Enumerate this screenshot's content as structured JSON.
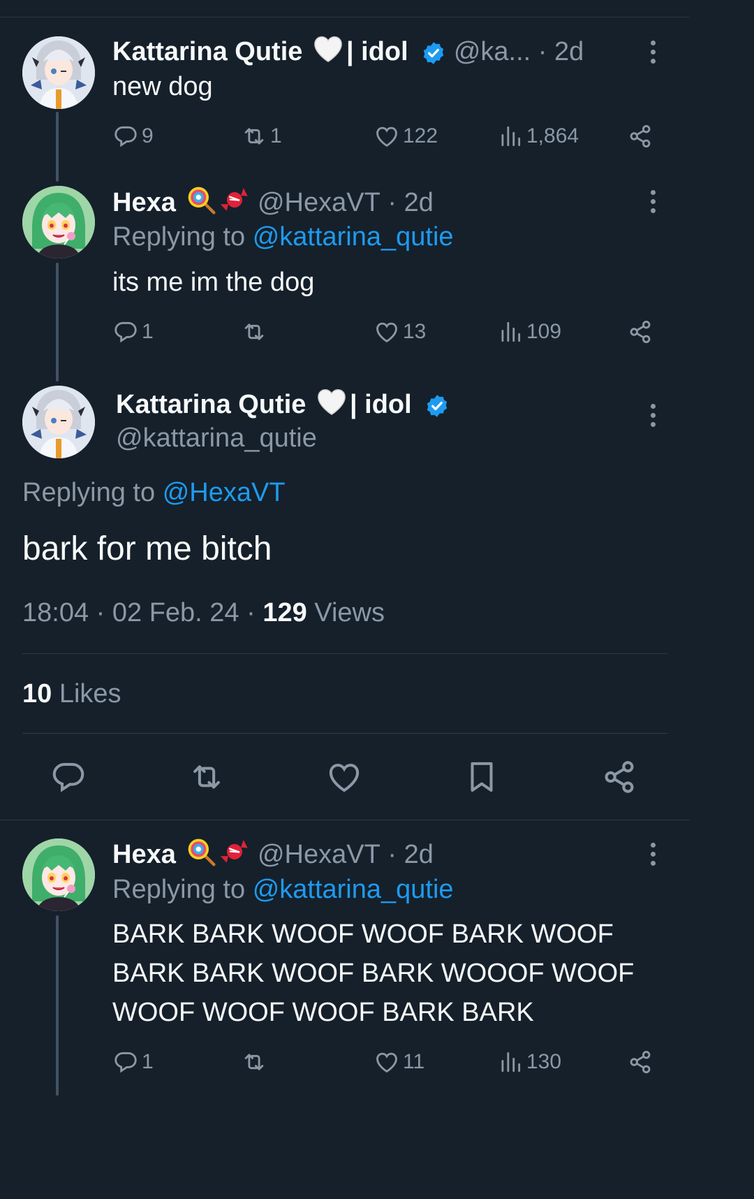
{
  "tweets": [
    {
      "name": "Kattarina Qutie",
      "name_suffix": "| idol",
      "handle": "@ka...",
      "time": "· 2d",
      "text": "new dog",
      "replies": "9",
      "retweets": "1",
      "likes": "122",
      "views": "1,864"
    },
    {
      "name": "Hexa",
      "handle": "@HexaVT",
      "time": "· 2d",
      "replying_prefix": "Replying to",
      "replying_to": "@kattarina_qutie",
      "text": "its me im the dog",
      "replies": "1",
      "retweets": "",
      "likes": "13",
      "views": "109"
    }
  ],
  "main": {
    "name": "Kattarina Qutie",
    "name_suffix": "| idol",
    "handle": "@kattarina_qutie",
    "replying_prefix": "Replying to",
    "replying_to": "@HexaVT",
    "text": "bark for me bitch",
    "timestamp": "18:04 · 02 Feb. 24 ·",
    "views_count": "129",
    "views_label": "Views",
    "likes_count": "10",
    "likes_label": "Likes"
  },
  "reply": {
    "name": "Hexa",
    "handle": "@HexaVT",
    "time": "· 2d",
    "replying_prefix": "Replying to",
    "replying_to": "@kattarina_qutie",
    "text": "BARK BARK WOOF WOOF BARK WOOF BARK BARK WOOF BARK WOOOF WOOF WOOF WOOF WOOF BARK BARK",
    "replies": "1",
    "retweets": "",
    "likes": "11",
    "views": "130"
  },
  "colors": {
    "background": "#15202b",
    "accent": "#1d9bf0",
    "muted": "#8b98a5",
    "text": "#f7f9f9"
  },
  "icons": [
    "reply-icon",
    "retweet-icon",
    "like-icon",
    "views-icon",
    "share-icon",
    "bookmark-icon",
    "verified-icon",
    "more-icon"
  ]
}
